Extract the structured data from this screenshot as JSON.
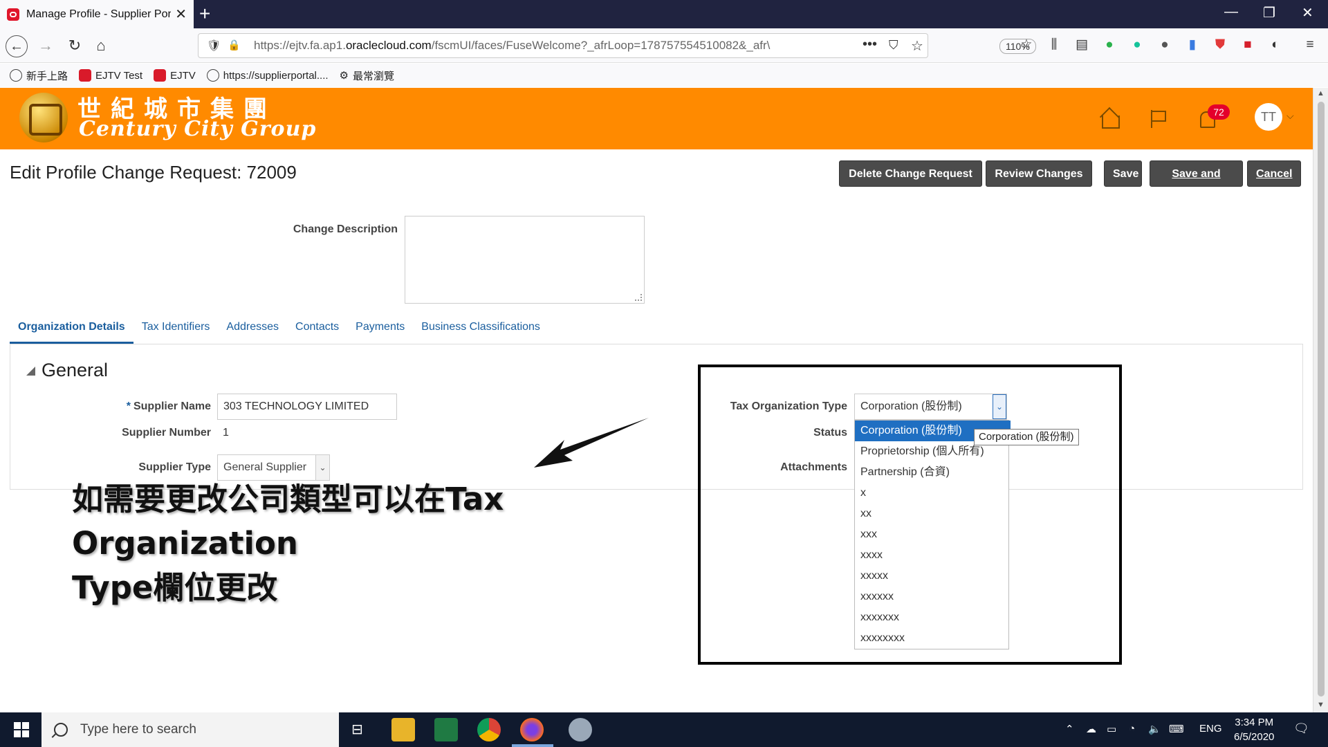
{
  "browser": {
    "tab_title": "Manage Profile - Supplier Portal",
    "tab_close": "✕",
    "new_tab": "+",
    "url_host_prefix": "https://ejtv.fa.ap1.",
    "url_domain": "oraclecloud.com",
    "url_path": "/fscmUI/faces/FuseWelcome?_afrLoop=17875755451008​2&_afr\\",
    "zoom": "110%",
    "bookmarks": [
      "新手上路",
      "EJTV Test",
      "EJTV",
      "https://supplierportal....",
      "最常瀏覽"
    ]
  },
  "header": {
    "company_cn": "世紀城市集團",
    "company_en": "Century City Group",
    "notification_count": "72",
    "avatar_initials": "TT"
  },
  "page": {
    "title": "Edit Profile Change Request: 72009",
    "buttons": {
      "delete": "Delete Change Request",
      "review": "Review Changes",
      "save": "Save",
      "save_close": "Save and Close",
      "cancel": "Cancel"
    },
    "change_description_label": "Change Description",
    "change_description_value": ""
  },
  "tabs": [
    "Organization Details",
    "Tax Identifiers",
    "Addresses",
    "Contacts",
    "Payments",
    "Business Classifications"
  ],
  "active_tab": "Organization Details",
  "general": {
    "section_title": "General",
    "supplier_name_label": "Supplier Name",
    "supplier_name_value": "303 TECHNOLOGY LIMITED",
    "supplier_number_label": "Supplier Number",
    "supplier_number_value": "1",
    "supplier_type_label": "Supplier Type",
    "supplier_type_value": "General Supplier",
    "tax_org_type_label": "Tax Organization Type",
    "tax_org_type_value": "Corporation (股份制)",
    "status_label": "Status",
    "attachments_label": "Attachments"
  },
  "tax_org_dropdown": {
    "options": [
      "Corporation (股份制)",
      "Proprietorship (個人所有)",
      "Partnership (合資)",
      "x",
      "xx",
      "xxx",
      "xxxx",
      "xxxxx",
      "xxxxxx",
      "xxxxxxx",
      "xxxxxxxx"
    ],
    "selected_index": 0,
    "tooltip": "Corporation (股份制)"
  },
  "annotation": {
    "line1": "如需要更改公司類型可以在Tax Organization",
    "line2": "Type欄位更改"
  },
  "taskbar": {
    "search_placeholder": "Type here to search",
    "language": "ENG",
    "time": "3:34 PM",
    "date": "6/5/2020"
  },
  "colors": {
    "header_bg": "#ff8a00",
    "action_button_bg": "#4b4b4b",
    "link_blue": "#1a5e9e",
    "dropdown_selected": "#1f6fc2"
  }
}
